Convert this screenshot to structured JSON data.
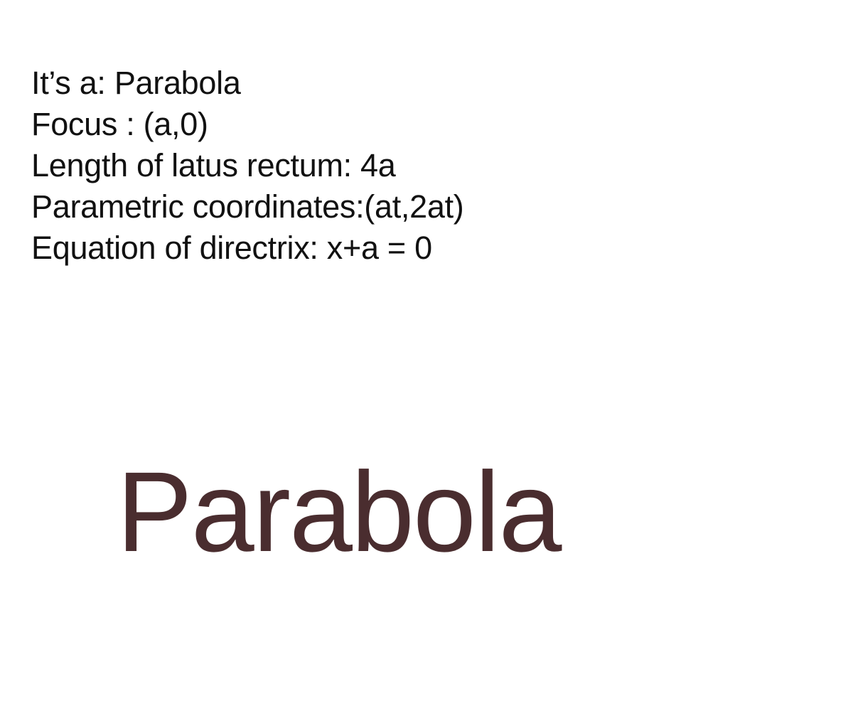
{
  "info": {
    "line1": "It’s a: Parabola",
    "line2": "Focus : (a,0)",
    "line3": "Length of latus rectum: 4a",
    "line4": "Parametric coordinates:(at,2at)",
    "line5": "Equation of directrix: x+a = 0"
  },
  "title": "Parabola",
  "colors": {
    "title": "#4a2d2f",
    "text": "#111111",
    "background": "#ffffff"
  }
}
